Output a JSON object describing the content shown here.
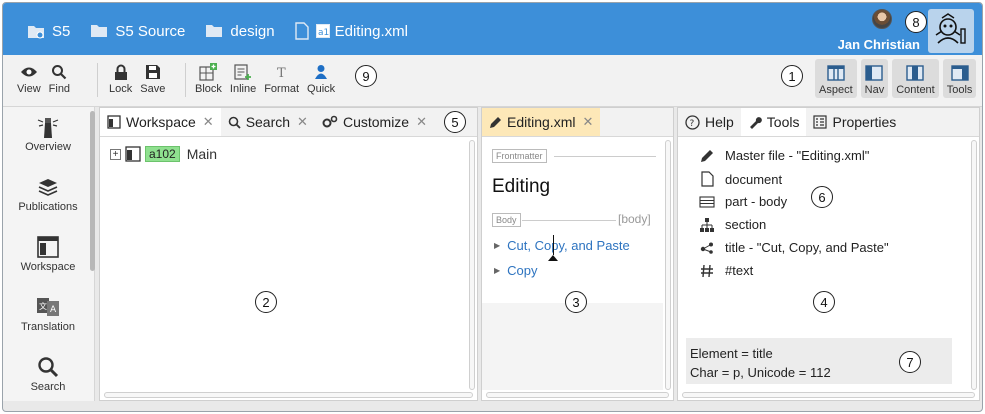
{
  "breadcrumbs": [
    {
      "label": "S5",
      "icon": "database-folder-icon"
    },
    {
      "label": "S5 Source",
      "icon": "folder-icon"
    },
    {
      "label": "design",
      "icon": "folder-icon"
    },
    {
      "label": "Editing.xml",
      "icon": "xml-file-icon"
    }
  ],
  "user": {
    "name": "Jan Christian"
  },
  "toolbar": {
    "view": "View",
    "find": "Find",
    "lock": "Lock",
    "save": "Save",
    "block": "Block",
    "inline": "Inline",
    "format": "Format",
    "quick": "Quick",
    "views": [
      "Aspect",
      "Nav",
      "Content",
      "Tools"
    ]
  },
  "nav": {
    "items": [
      "Overview",
      "Publications",
      "Workspace",
      "Translation",
      "Search"
    ]
  },
  "workspace": {
    "tabs": [
      "Workspace",
      "Search",
      "Customize"
    ],
    "tree": {
      "badge": "a102",
      "label": "Main"
    }
  },
  "editor": {
    "tab": "Editing.xml",
    "frontmatter_label": "Frontmatter",
    "title": "Editing",
    "body_label": "Body",
    "body_tag": "[body]",
    "items": [
      "Cut, Copy, and Paste",
      "Copy"
    ]
  },
  "tools": {
    "tabs": [
      "Help",
      "Tools",
      "Properties"
    ],
    "rows": [
      {
        "icon": "pencil-icon",
        "text": "Master file - \"Editing.xml\""
      },
      {
        "icon": "document-icon",
        "text": "document"
      },
      {
        "icon": "part-icon",
        "text": "part - body"
      },
      {
        "icon": "hierarchy-icon",
        "text": "section"
      },
      {
        "icon": "share-node-icon",
        "text": "title - \"Cut, Copy, and Paste\""
      },
      {
        "icon": "hash-icon",
        "text": "#text"
      }
    ],
    "status_line1": "Element = title",
    "status_line2": "Char = p, Unicode = 112"
  },
  "callouts": [
    "1",
    "2",
    "3",
    "4",
    "5",
    "6",
    "7",
    "8",
    "9"
  ],
  "colors": {
    "topbar": "#3d8fd9",
    "accent_tab": "#fde8b8",
    "link": "#2e74c0",
    "badge": "#8fe08f"
  }
}
